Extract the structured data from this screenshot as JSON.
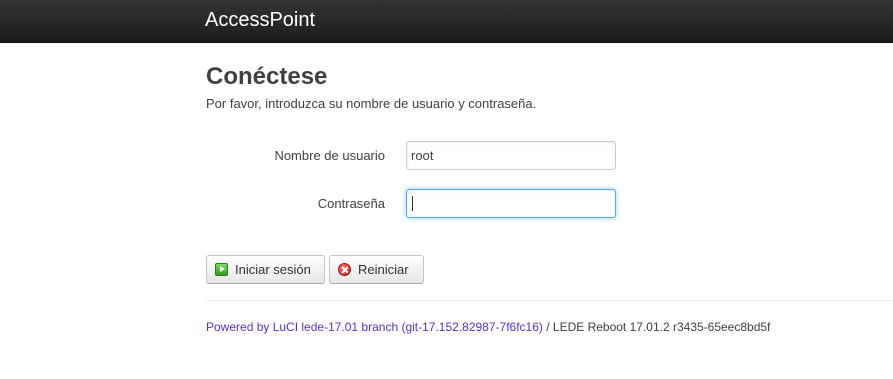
{
  "header": {
    "brand": "AccessPoint"
  },
  "login": {
    "title": "Conéctese",
    "description": "Por favor, introduzca su nombre de usuario y contraseña.",
    "username_label": "Nombre de usuario",
    "username_value": "root",
    "password_label": "Contraseña",
    "password_value": ""
  },
  "buttons": {
    "login_label": "Iniciar sesión",
    "reset_label": "Reiniciar"
  },
  "footer": {
    "link_text": "Powered by LuCI lede-17.01 branch (git-17.152.82987-7f6fc16)",
    "suffix": " / LEDE Reboot 17.01.2 r3435-65eec8bd5f"
  },
  "colors": {
    "header_bg": "#222222",
    "link": "#5c2fc4",
    "focus_border": "#52a8ec"
  }
}
